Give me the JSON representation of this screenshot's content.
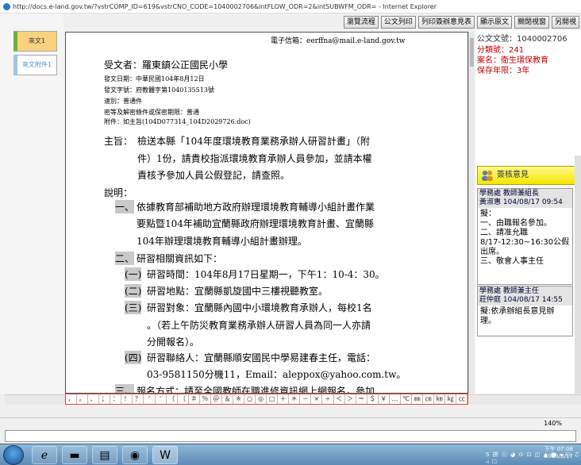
{
  "window": {
    "title": "http://docs.e-land.gov.tw/?vstrCOMP_ID=619&vstrCNO_CODE=1040002706&intFLOW_ODR=2&intSUBWFM_ODR= - Internet Explorer"
  },
  "toolbar": {
    "buttons": [
      "瀏覽流程",
      "公文列印",
      "列印簽辦意見表",
      "顯示原文",
      "關閉視窗",
      "另開視"
    ]
  },
  "tabs": [
    "來文1",
    "來文附件1"
  ],
  "doc": {
    "email": "電子信箱：eerffna@mail.e-land.gov.tw",
    "recipient": "受文者：羅東鎮公正國民小學",
    "date": "發文日期：中華民國104年8月12日",
    "number": "發文字號：府教體字第1040135513號",
    "speed": "速別：普通件",
    "secret": "密等及解密條件或保密期限：普通",
    "attach": "附件：如主旨(104D077314_104D2029726.doc)",
    "subject_label": "主旨：",
    "subject": [
      "檢送本縣「104年度環境教育業務承辦人研習計畫」（附",
      "件）1份，請貴校指派環境教育承辦人員參加，並請本權",
      "責核予參加人員公假登記，請查照。"
    ],
    "explain_label": "說明：",
    "item1_num": "一、",
    "item1": [
      "依據教育部補助地方政府辦理環境教育輔導小組計畫作業",
      "要點暨104年補助宜蘭縣政府辦理環境教育計畫、宜蘭縣",
      "104年辦理環境教育輔導小組計畫辦理。"
    ],
    "item2_num": "二、",
    "item2": "研習相關資訊如下：",
    "sub1_num": "(一)",
    "sub1": "研習時間：104年8月17日星期一，下午1：10-4：30。",
    "sub2_num": "(二)",
    "sub2": "研習地點：宜蘭縣凱旋國中三樓視聽教室。",
    "sub3_num": "(三)",
    "sub3": [
      "研習對象：宜蘭縣內國中小環境教育承辦人，每校1名",
      "。（若上午防災教育業務承辦人研習人員為同一人亦請",
      "分開報名）。"
    ],
    "sub4_num": "(四)",
    "sub4": [
      "研習聯絡人：宜蘭縣順安國民中學易建春主任，電話：",
      "03-9581150分機11，Email：aleppox@yahoo.com.tw。"
    ],
    "item3_num": "三、",
    "item3": "報名方式：請至全國教師在職進修資訊網上網報名，參加"
  },
  "symbols": [
    "，",
    "。",
    "、",
    "；",
    "：",
    "！",
    "？",
    "‘",
    "’",
    "（",
    "〔",
    "＃",
    "％",
    "＠",
    "＆",
    "※",
    "○",
    "◎",
    "□",
    "＋",
    "＊",
    "－",
    "×",
    "÷",
    "＜",
    "＞",
    "＝",
    "＄",
    "￥",
    "…",
    "℃",
    "㎜",
    "㎝",
    "㎞",
    "㎏",
    "㏄"
  ],
  "side": {
    "doc_no": "公文文號：1040002706",
    "category": "分類號：241",
    "case_name": "案名：衛生環保教育",
    "retention": "保存年限：3年",
    "sign_title": "簽核意見",
    "opinions": [
      {
        "role": "學務處 教師兼組長",
        "name": "黃淑惠",
        "time": "104/08/17 09:54",
        "text": [
          "擬：",
          "一、由職報名參加。",
          "二、請准允職",
          "8/17-12:30~16:30公假",
          "出席。",
          "三、敬會人事主任"
        ]
      },
      {
        "role": "學務處 教師兼主任",
        "name": "莊仲庭",
        "time": "104/08/17 14:55",
        "text": [
          "擬:依承辦組長意見辦",
          "理。"
        ]
      }
    ]
  },
  "status": {
    "zoom": "140%"
  },
  "taskbar": {
    "time": "下午 07:08",
    "date": "2015/8/17",
    "tray": "S 拼 ⓤ ◕ ⊙ ⊡ ◫ ▲ ■ ◂ ☐ ♫ ◃ ☐"
  },
  "colors": {
    "accent_red": "#c00000",
    "sign_yellow": "#f5ea00"
  }
}
